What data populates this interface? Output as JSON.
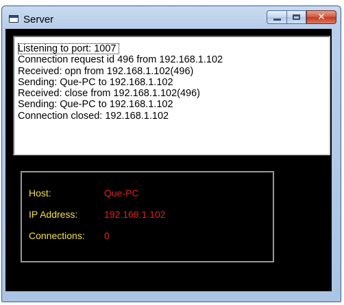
{
  "window": {
    "title": "Server",
    "buttons": {
      "minimize": "minimize",
      "maximize": "maximize",
      "close": "✕"
    }
  },
  "log": {
    "lines": [
      "Listening to port: 1007",
      "Connection request id 496 from 192.168.1.102",
      "Received: opn from 192.168.1.102(496)",
      "Sending: Que-PC to 192.168.1.102",
      "Received: close from 192.168.1.102(496)",
      "Sending: Que-PC to 192.168.1.102",
      "Connection closed: 192.168.1.102"
    ]
  },
  "info": {
    "host_label": "Host:",
    "host_value": "Que-PC",
    "ip_label": "IP Address:",
    "ip_value": "192.168.1.102",
    "connections_label": "Connections:",
    "connections_value": "0"
  },
  "colors": {
    "label": "#f5e04a",
    "value": "#e0201c",
    "background": "#000000"
  },
  "icons": [
    "app-window-icon",
    "minimize-icon",
    "maximize-icon",
    "close-icon"
  ]
}
